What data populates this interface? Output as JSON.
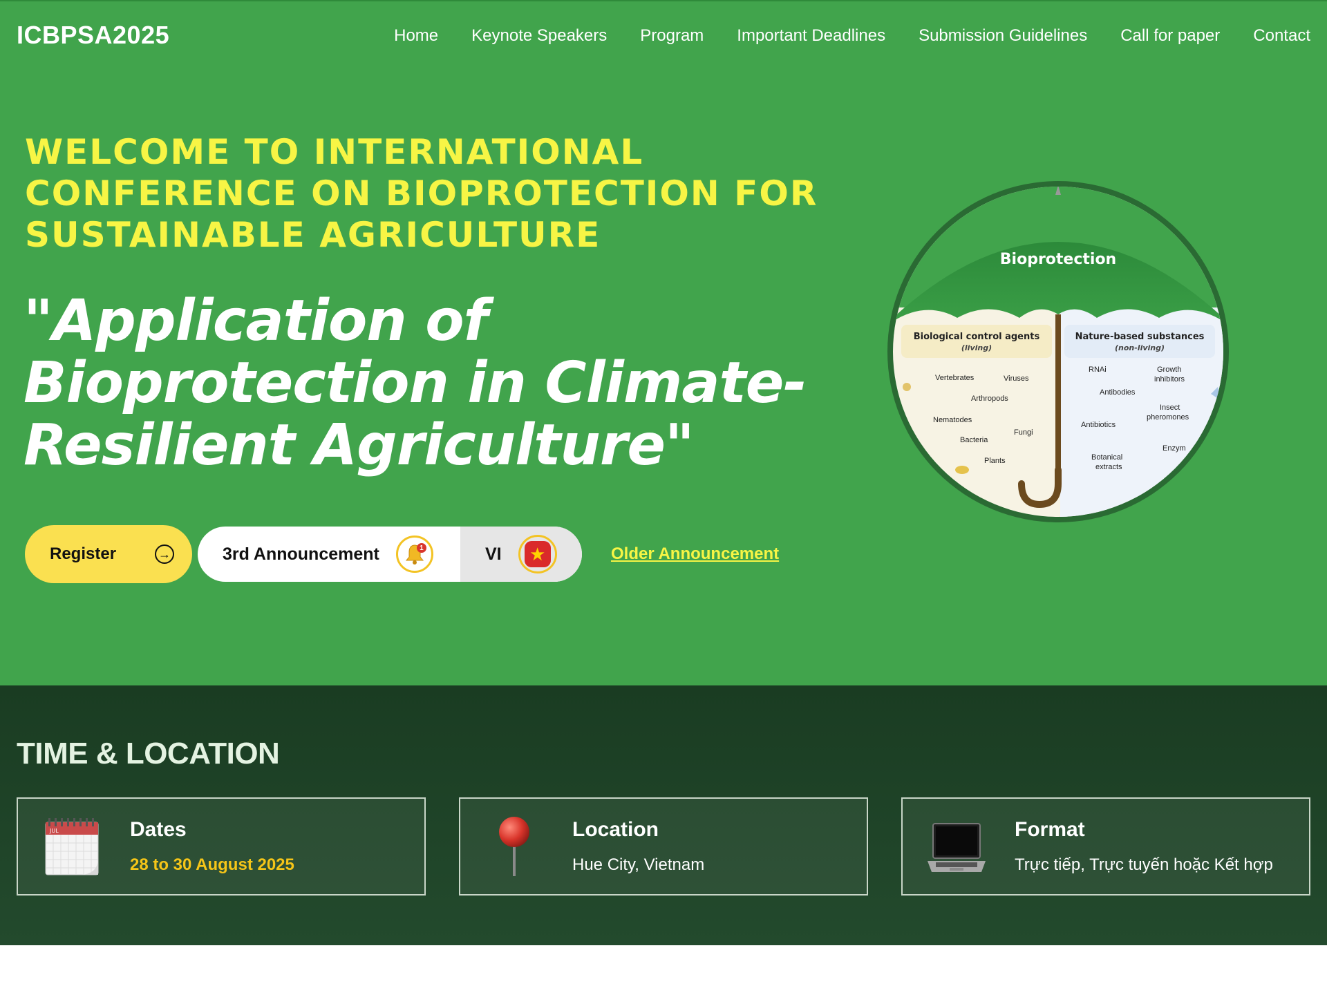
{
  "brand": "ICBPSA2025",
  "nav": [
    "Home",
    "Keynote Speakers",
    "Program",
    "Important Deadlines",
    "Submission Guidelines",
    "Call for paper",
    "Contact"
  ],
  "hero": {
    "welcome": "WELCOME TO INTERNATIONAL CONFERENCE ON BIOPROTECTION FOR SUSTAINABLE AGRICULTURE",
    "theme": "\"Application of Bioprotection in Climate-Resilient Agriculture\"",
    "register_label": "Register",
    "announcement_label": "3rd Announcement",
    "announcement_badge": "1",
    "lang_label": "VI",
    "older_label": "Older Announcement",
    "illustration": {
      "title": "Bioprotection",
      "left_heading": "Biological control agents",
      "left_sub": "(living)",
      "left_items": [
        "Vertebrates",
        "Viruses",
        "Arthropods",
        "Nematodes",
        "Fungi",
        "Bacteria",
        "Plants"
      ],
      "right_heading": "Nature-based substances",
      "right_sub": "(non-living)",
      "right_items": [
        "RNAi",
        "Growth",
        "inhibitors",
        "Antibodies",
        "Insect",
        "pheromones",
        "Antibiotics",
        "Enzym",
        "Botanical",
        "extracts"
      ]
    }
  },
  "time_location": {
    "title": "TIME & LOCATION",
    "cards": [
      {
        "icon": "calendar-icon",
        "label": "Dates",
        "value": "28 to 30 August 2025",
        "calendar_month": "JUL"
      },
      {
        "icon": "pushpin-icon",
        "label": "Location",
        "value": "Hue City, Vietnam"
      },
      {
        "icon": "laptop-icon",
        "label": "Format",
        "value": "Trực tiếp, Trực tuyến hoặc Kết hợp"
      }
    ]
  },
  "colors": {
    "hero_bg": "#41a44c",
    "headline_yellow": "#f7f545",
    "button_yellow": "#fae050",
    "section_dark": "#1a3c22",
    "date_highlight": "#f5c518"
  }
}
